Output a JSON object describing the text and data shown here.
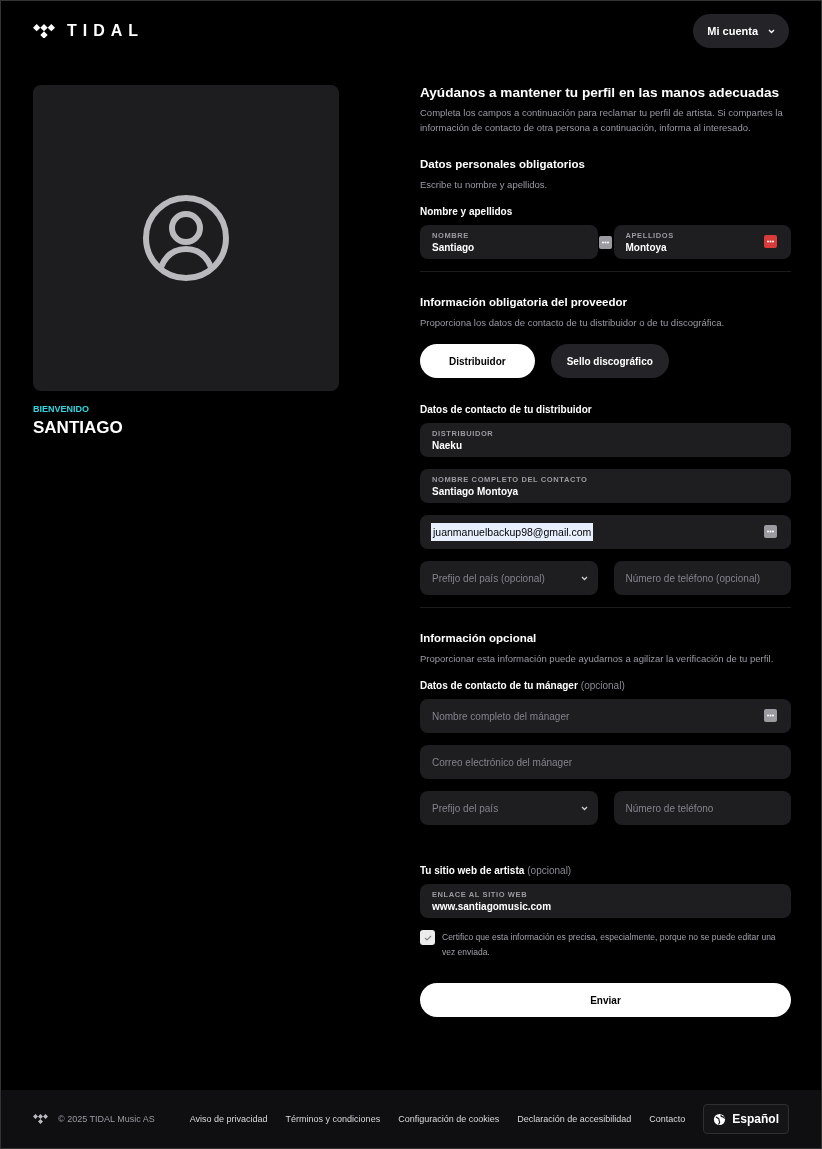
{
  "header": {
    "logo": "TIDAL",
    "account_button": "Mi cuenta"
  },
  "profile": {
    "greeting": "BIENVENIDO",
    "name": "SANTIAGO"
  },
  "form": {
    "title": "Ayúdanos a mantener tu perfil en las manos adecuadas",
    "intro": "Completa los campos a continuación para reclamar tu perfil de artista. Si compartes la información de contacto de otra persona a continuación, informa al interesado.",
    "sections": [
      {
        "title": "Datos personales obligatorios",
        "description": "Escribe tu nombre y apellidos.",
        "blocks": [
          {
            "kind": "label",
            "text": "Nombre y apellidos"
          },
          {
            "kind": "row",
            "fields": [
              {
                "kind": "text",
                "label": "NOMBRE",
                "value": "Santiago",
                "manager_icon": true,
                "manager_warning": false
              },
              {
                "kind": "text",
                "label": "APELLIDOS",
                "value": "Montoya",
                "manager_icon": true,
                "manager_warning": true
              }
            ]
          }
        ]
      },
      {
        "title": "Información obligatoria del proveedor",
        "description": "Proporciona los datos de contacto de tu distribuidor o de tu discográfica.",
        "blocks": [
          {
            "kind": "tabs",
            "tabs": [
              {
                "label": "Distribuidor",
                "selected": true
              },
              {
                "label": "Sello discográfico",
                "selected": false
              }
            ]
          },
          {
            "kind": "label",
            "text": "Datos de contacto de tu distribuidor"
          },
          {
            "kind": "row",
            "fields": [
              {
                "kind": "text",
                "label": "DISTRIBUIDOR",
                "value": "Naeku"
              }
            ]
          },
          {
            "kind": "row",
            "fields": [
              {
                "kind": "text",
                "label": "NOMBRE COMPLETO DEL CONTACTO",
                "value": "Santiago Montoya"
              }
            ]
          },
          {
            "kind": "row",
            "fields": [
              {
                "kind": "text",
                "value": "juanmanuelbackup98@gmail.com",
                "autofilled": true,
                "manager_icon": true,
                "manager_warning": false
              }
            ]
          },
          {
            "kind": "row",
            "fields": [
              {
                "kind": "select",
                "placeholder": "Prefijo del país (opcional)"
              },
              {
                "kind": "text",
                "placeholder": "Número de teléfono (opcional)"
              }
            ]
          }
        ]
      },
      {
        "title": "Información opcional",
        "description": "Proporcionar esta información puede ayudarnos a agilizar la verificación de tu perfil.",
        "blocks": [
          {
            "kind": "label",
            "text": "Datos de contacto de tu mánager",
            "suffix": "(opcional)"
          },
          {
            "kind": "row",
            "fields": [
              {
                "kind": "text",
                "placeholder": "Nombre completo del mánager",
                "manager_icon": true,
                "manager_warning": false
              }
            ]
          },
          {
            "kind": "row",
            "fields": [
              {
                "kind": "text",
                "placeholder": "Correo electrónico del mánager"
              }
            ]
          },
          {
            "kind": "row",
            "fields": [
              {
                "kind": "select",
                "placeholder": "Prefijo del país"
              },
              {
                "kind": "text",
                "placeholder": "Número de teléfono"
              }
            ]
          },
          {
            "kind": "gap"
          },
          {
            "kind": "label",
            "text": "Tu sitio web de artista",
            "suffix": "(opcional)"
          },
          {
            "kind": "row",
            "fields": [
              {
                "kind": "text",
                "label": "ENLACE AL SITIO WEB",
                "value": "www.santiagomusic.com"
              }
            ]
          },
          {
            "kind": "checkbox",
            "text": "Certifico que esta información es precisa, especialmente, porque no se puede editar una vez enviada.",
            "checked": true
          }
        ]
      }
    ],
    "submit": "Enviar"
  },
  "footer": {
    "copyright": "© 2025 TIDAL Music AS",
    "links": [
      "Aviso de privacidad",
      "Términos y condiciones",
      "Configuración de cookies",
      "Declaración de accesibilidad",
      "Contacto"
    ],
    "language": "Español"
  }
}
